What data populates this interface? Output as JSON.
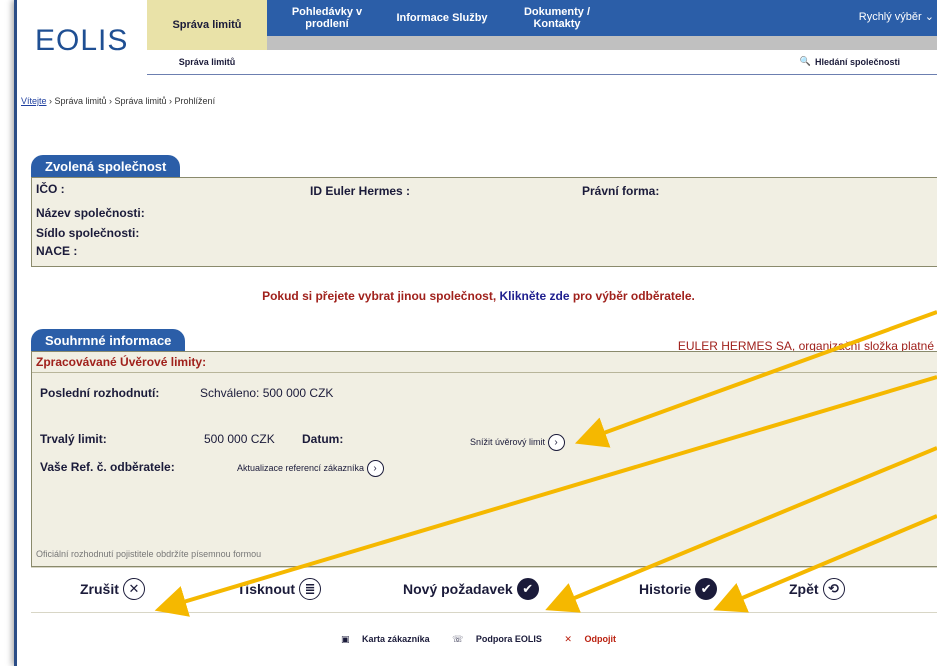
{
  "header": {
    "logo": "EOLIS",
    "tabs": [
      {
        "label": "Správa limitů"
      },
      {
        "label": "Pohledávky v prodlení"
      },
      {
        "label": "Informace Služby"
      },
      {
        "label": "Dokumenty / Kontakty"
      }
    ],
    "quick_select": "Rychlý výběr",
    "subtab": "Správa limitů",
    "search_link": "Hledání společnosti"
  },
  "breadcrumb": {
    "home": "Vítejte",
    "path": " › Správa limitů › Správa limitů › Prohlížení"
  },
  "company_panel": {
    "tab": "Zvolená společnost",
    "ico_label": "IČO :",
    "eh_id_label": "ID Euler Hermes :",
    "legal_form_label": "Právní forma:",
    "name_label": "Název společnosti:",
    "seat_label": "Sídlo společnosti:",
    "nace_label": "NACE :"
  },
  "notice": {
    "before": "Pokud si přejete vybrat jinou společnost, ",
    "link": "Klikněte zde",
    "after": " pro výběr odběratele."
  },
  "summary_panel": {
    "tab": "Souhrnné informace",
    "company_name": "EULER HERMES SA, organizační složka platné",
    "processed_title": "Zpracovávané Úvěrové limity:",
    "last_decision_label": "Poslední rozhodnutí:",
    "last_decision_value": "Schváleno: 500 000 CZK",
    "permanent_limit_label": "Trvalý limit:",
    "permanent_limit_value": "500 000 CZK",
    "date_label": "Datum:",
    "reduce_limit": "Snížit úvěrový limit",
    "ref_label": "Vaše Ref. č. odběratele:",
    "update_ref": "Aktualizace referencí zákazníka",
    "note": "Oficiální rozhodnutí pojistitele obdržíte písemnou formou"
  },
  "actions": {
    "cancel": "Zrušit",
    "print": "Tisknout",
    "new_request": "Nový požadavek",
    "history": "Historie",
    "back": "Zpět"
  },
  "footer": {
    "customer_card": "Karta zákazníka",
    "support": "Podpora EOLIS",
    "logout": "Odpojit"
  },
  "colors": {
    "nav_blue": "#2b5ea8",
    "active_tab": "#e9e2a8",
    "panel_bg": "#f1efe3",
    "red_text": "#a0211c",
    "annotation_arrow": "#f5b800"
  }
}
